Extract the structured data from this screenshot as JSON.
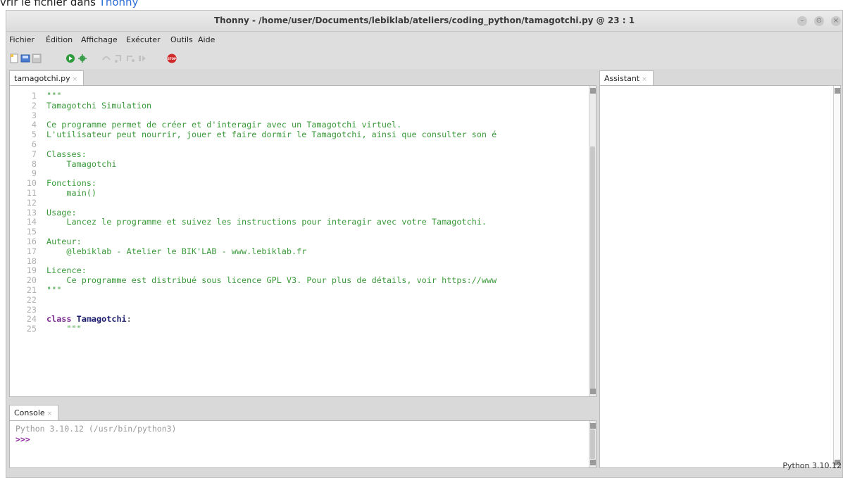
{
  "caption": {
    "prefix": "vrir le fichier dans ",
    "link": "Thonny"
  },
  "window": {
    "title": "Thonny - /home/user/Documents/lebiklab/ateliers/coding_python/tamagotchi.py @ 23 : 1",
    "controls": [
      "–",
      "⊙",
      "×"
    ]
  },
  "menu": [
    "Fichier",
    "Édition",
    "Affichage",
    "Exécuter",
    "Outils",
    "Aide"
  ],
  "toolbar": {
    "icons": [
      "new-file-icon",
      "open-file-icon",
      "save-file-icon",
      "run-icon",
      "debug-icon",
      "step-over-icon",
      "step-into-icon",
      "step-out-icon",
      "resume-icon",
      "stop-icon"
    ],
    "stop_label": "STOP"
  },
  "editor": {
    "tab_label": "tamagotchi.py",
    "lines": [
      {
        "n": "1",
        "text": "\"\"\"",
        "cls": "str"
      },
      {
        "n": "2",
        "text": "Tamagotchi Simulation",
        "cls": "str"
      },
      {
        "n": "3",
        "text": "",
        "cls": "str"
      },
      {
        "n": "4",
        "text": "Ce programme permet de créer et d'interagir avec un Tamagotchi virtuel.",
        "cls": "str"
      },
      {
        "n": "5",
        "text": "L'utilisateur peut nourrir, jouer et faire dormir le Tamagotchi, ainsi que consulter son é",
        "cls": "str"
      },
      {
        "n": "6",
        "text": "",
        "cls": "str"
      },
      {
        "n": "7",
        "text": "Classes:",
        "cls": "str"
      },
      {
        "n": "8",
        "text": "    Tamagotchi",
        "cls": "str"
      },
      {
        "n": "9",
        "text": "",
        "cls": "str"
      },
      {
        "n": "10",
        "text": "Fonctions:",
        "cls": "str"
      },
      {
        "n": "11",
        "text": "    main()",
        "cls": "str"
      },
      {
        "n": "12",
        "text": "",
        "cls": "str"
      },
      {
        "n": "13",
        "text": "Usage:",
        "cls": "str"
      },
      {
        "n": "14",
        "text": "    Lancez le programme et suivez les instructions pour interagir avec votre Tamagotchi.",
        "cls": "str"
      },
      {
        "n": "15",
        "text": "",
        "cls": "str"
      },
      {
        "n": "16",
        "text": "Auteur:",
        "cls": "str"
      },
      {
        "n": "17",
        "text": "    @lebiklab - Atelier le BIK'LAB - www.lebiklab.fr",
        "cls": "str"
      },
      {
        "n": "18",
        "text": "",
        "cls": "str"
      },
      {
        "n": "19",
        "text": "Licence:",
        "cls": "str"
      },
      {
        "n": "20",
        "text": "    Ce programme est distribué sous licence GPL V3. Pour plus de détails, voir https://www",
        "cls": "str"
      },
      {
        "n": "21",
        "text": "\"\"\"",
        "cls": "str"
      },
      {
        "n": "22",
        "text": "",
        "cls": "str"
      },
      {
        "n": "23",
        "text": "",
        "cls": "str"
      },
      {
        "n": "24",
        "kw": "class",
        "name": "Tamagotchi",
        "rest": ":",
        "cls": "class"
      },
      {
        "n": "25",
        "text": "    \"\"\"",
        "cls": "str"
      }
    ]
  },
  "console": {
    "tab_label": "Console",
    "info": "Python 3.10.12 (/usr/bin/python3)",
    "prompt": ">>>"
  },
  "assistant": {
    "tab_label": "Assistant"
  },
  "status": {
    "interpreter": "Python 3.10.12"
  },
  "colors": {
    "string": "#3a9a3a",
    "keyword": "#7a2b8f",
    "prompt": "#8a1f9a",
    "link": "#2a6bd6"
  }
}
